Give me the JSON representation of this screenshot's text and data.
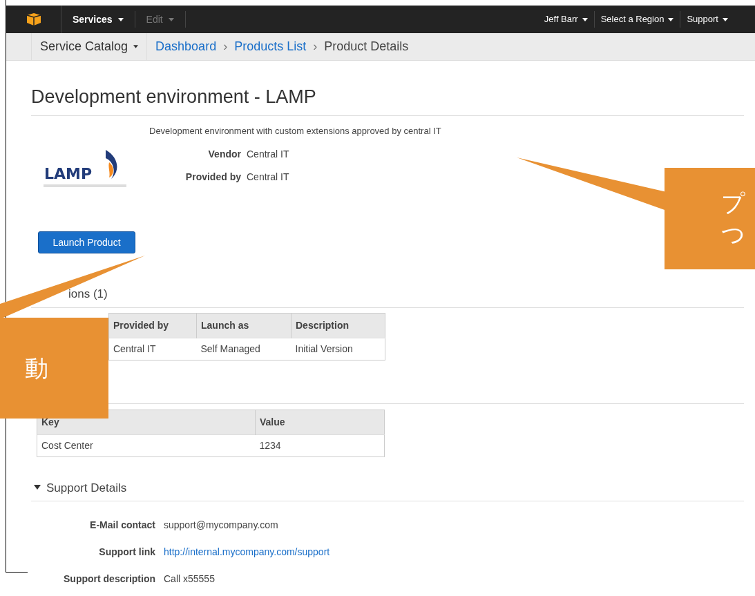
{
  "top_nav": {
    "menus": [
      {
        "label": "Services",
        "disabled": false
      },
      {
        "label": "Edit",
        "disabled": true
      }
    ],
    "right_menus": [
      "Jeff Barr",
      "Select a Region",
      "Support"
    ]
  },
  "breadcrumb_bar": {
    "service_menu": "Service Catalog",
    "separator": "›",
    "crumbs": [
      {
        "label": "Dashboard",
        "link": true
      },
      {
        "label": "Products List",
        "link": true
      },
      {
        "label": "Product Details",
        "link": false
      }
    ]
  },
  "product": {
    "logo_text": "LAMP",
    "title": "Development environment - LAMP",
    "description": "Development environment with custom extensions approved by central IT",
    "fields": [
      {
        "label": "Vendor",
        "value": "Central IT"
      },
      {
        "label": "Provided by",
        "value": "Central IT"
      }
    ],
    "launch_button": "Launch Product"
  },
  "versions": {
    "heading": "ions (1)",
    "columns": [
      "Provided by",
      "Launch as",
      "Description"
    ],
    "rows": [
      [
        "Central IT",
        "Self Managed",
        "Initial Version"
      ]
    ]
  },
  "tags": {
    "columns": [
      "Key",
      "Value"
    ],
    "rows": [
      [
        "Cost Center",
        "1234"
      ]
    ]
  },
  "support": {
    "heading": "Support Details",
    "expanded": true,
    "fields": [
      {
        "label": "E-Mail contact",
        "value": "support@mycompany.com",
        "link": false
      },
      {
        "label": "Support link",
        "value": "http://internal.mycompany.com/support",
        "link": true
      },
      {
        "label": "Support description",
        "value": "Call x55555",
        "link": false
      }
    ]
  },
  "callouts": [
    {
      "lines": [
        "プ",
        "つ"
      ]
    },
    {
      "lines": [
        "動"
      ]
    }
  ]
}
